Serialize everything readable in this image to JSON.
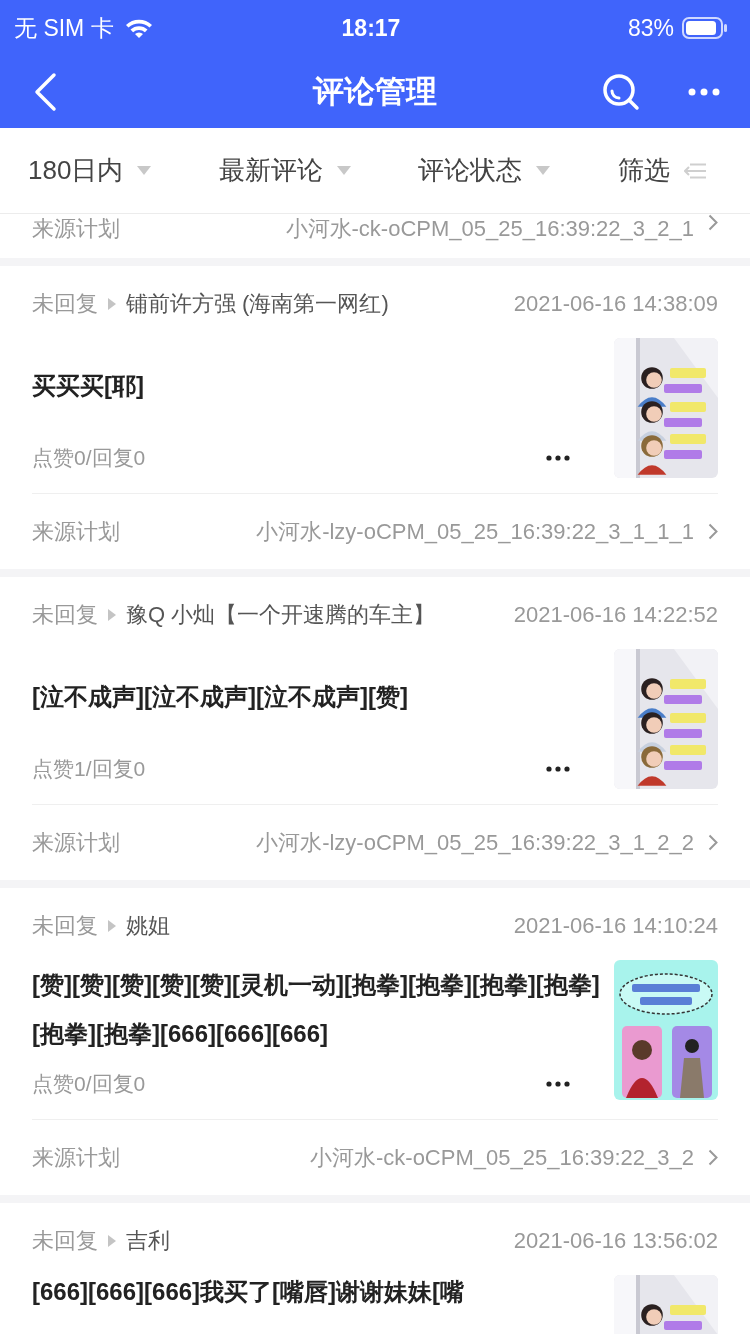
{
  "status_bar": {
    "carrier": "无 SIM 卡",
    "time": "18:17",
    "battery": "83%"
  },
  "nav": {
    "title": "评论管理"
  },
  "filters": [
    {
      "label": "180日内",
      "kind": "dropdown"
    },
    {
      "label": "最新评论",
      "kind": "dropdown"
    },
    {
      "label": "评论状态",
      "kind": "dropdown"
    },
    {
      "label": "筛选",
      "kind": "filter"
    }
  ],
  "partial_card": {
    "source_label": "来源计划",
    "source_value": "小河水-ck-oCPM_05_25_16:39:22_3_2_1"
  },
  "comments": [
    {
      "status": "未回复",
      "author": "铺前许方强 (海南第一网红)",
      "time": "2021-06-16 14:38:09",
      "text": "买买买[耶]",
      "stats": "点赞0/回复0",
      "source_label": "来源计划",
      "source_value": "小河水-lzy-oCPM_05_25_16:39:22_3_1_1_1",
      "kind": "picture"
    },
    {
      "status": "未回复",
      "author": "豫Q 小灿【一个开速腾的车主】",
      "time": "2021-06-16 14:22:52",
      "text": "[泣不成声][泣不成声][泣不成声][赞]",
      "stats": "点赞1/回复0",
      "source_label": "来源计划",
      "source_value": "小河水-lzy-oCPM_05_25_16:39:22_3_1_2_2",
      "kind": "picture"
    },
    {
      "status": "未回复",
      "author": "姚姐",
      "time": "2021-06-16 14:10:24",
      "text": "[赞][赞][赞][赞][赞][灵机一动][抱拳][抱拳][抱拳][抱拳][抱拳][抱拳][666][666][666]",
      "stats": "点赞0/回复0",
      "source_label": "来源计划",
      "source_value": "小河水-ck-oCPM_05_25_16:39:22_3_2",
      "kind": "picture"
    },
    {
      "status": "未回复",
      "author": "吉利",
      "time": "2021-06-16 13:56:02",
      "text": "[666][666][666]我买了[嘴唇]谢谢妹妹[嘴",
      "kind": "picture"
    }
  ]
}
